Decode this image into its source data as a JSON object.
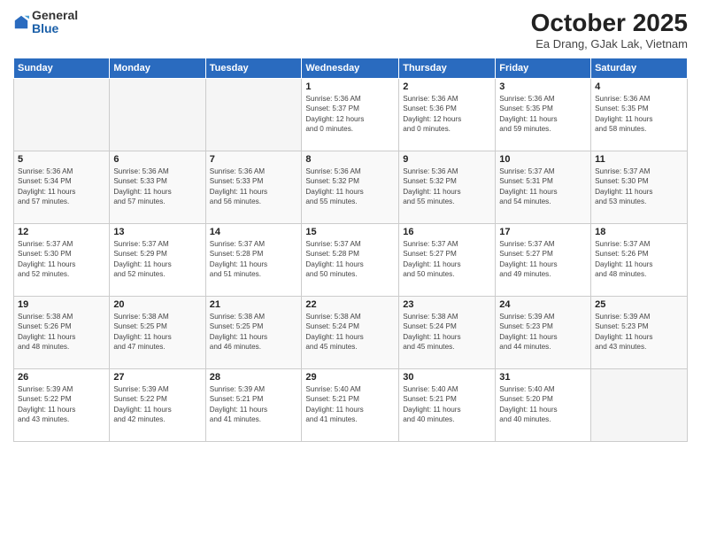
{
  "logo": {
    "general": "General",
    "blue": "Blue"
  },
  "header": {
    "month": "October 2025",
    "location": "Ea Drang, GJak Lak, Vietnam"
  },
  "weekdays": [
    "Sunday",
    "Monday",
    "Tuesday",
    "Wednesday",
    "Thursday",
    "Friday",
    "Saturday"
  ],
  "weeks": [
    [
      {
        "day": "",
        "info": ""
      },
      {
        "day": "",
        "info": ""
      },
      {
        "day": "",
        "info": ""
      },
      {
        "day": "1",
        "info": "Sunrise: 5:36 AM\nSunset: 5:37 PM\nDaylight: 12 hours\nand 0 minutes."
      },
      {
        "day": "2",
        "info": "Sunrise: 5:36 AM\nSunset: 5:36 PM\nDaylight: 12 hours\nand 0 minutes."
      },
      {
        "day": "3",
        "info": "Sunrise: 5:36 AM\nSunset: 5:35 PM\nDaylight: 11 hours\nand 59 minutes."
      },
      {
        "day": "4",
        "info": "Sunrise: 5:36 AM\nSunset: 5:35 PM\nDaylight: 11 hours\nand 58 minutes."
      }
    ],
    [
      {
        "day": "5",
        "info": "Sunrise: 5:36 AM\nSunset: 5:34 PM\nDaylight: 11 hours\nand 57 minutes."
      },
      {
        "day": "6",
        "info": "Sunrise: 5:36 AM\nSunset: 5:33 PM\nDaylight: 11 hours\nand 57 minutes."
      },
      {
        "day": "7",
        "info": "Sunrise: 5:36 AM\nSunset: 5:33 PM\nDaylight: 11 hours\nand 56 minutes."
      },
      {
        "day": "8",
        "info": "Sunrise: 5:36 AM\nSunset: 5:32 PM\nDaylight: 11 hours\nand 55 minutes."
      },
      {
        "day": "9",
        "info": "Sunrise: 5:36 AM\nSunset: 5:32 PM\nDaylight: 11 hours\nand 55 minutes."
      },
      {
        "day": "10",
        "info": "Sunrise: 5:37 AM\nSunset: 5:31 PM\nDaylight: 11 hours\nand 54 minutes."
      },
      {
        "day": "11",
        "info": "Sunrise: 5:37 AM\nSunset: 5:30 PM\nDaylight: 11 hours\nand 53 minutes."
      }
    ],
    [
      {
        "day": "12",
        "info": "Sunrise: 5:37 AM\nSunset: 5:30 PM\nDaylight: 11 hours\nand 52 minutes."
      },
      {
        "day": "13",
        "info": "Sunrise: 5:37 AM\nSunset: 5:29 PM\nDaylight: 11 hours\nand 52 minutes."
      },
      {
        "day": "14",
        "info": "Sunrise: 5:37 AM\nSunset: 5:28 PM\nDaylight: 11 hours\nand 51 minutes."
      },
      {
        "day": "15",
        "info": "Sunrise: 5:37 AM\nSunset: 5:28 PM\nDaylight: 11 hours\nand 50 minutes."
      },
      {
        "day": "16",
        "info": "Sunrise: 5:37 AM\nSunset: 5:27 PM\nDaylight: 11 hours\nand 50 minutes."
      },
      {
        "day": "17",
        "info": "Sunrise: 5:37 AM\nSunset: 5:27 PM\nDaylight: 11 hours\nand 49 minutes."
      },
      {
        "day": "18",
        "info": "Sunrise: 5:37 AM\nSunset: 5:26 PM\nDaylight: 11 hours\nand 48 minutes."
      }
    ],
    [
      {
        "day": "19",
        "info": "Sunrise: 5:38 AM\nSunset: 5:26 PM\nDaylight: 11 hours\nand 48 minutes."
      },
      {
        "day": "20",
        "info": "Sunrise: 5:38 AM\nSunset: 5:25 PM\nDaylight: 11 hours\nand 47 minutes."
      },
      {
        "day": "21",
        "info": "Sunrise: 5:38 AM\nSunset: 5:25 PM\nDaylight: 11 hours\nand 46 minutes."
      },
      {
        "day": "22",
        "info": "Sunrise: 5:38 AM\nSunset: 5:24 PM\nDaylight: 11 hours\nand 45 minutes."
      },
      {
        "day": "23",
        "info": "Sunrise: 5:38 AM\nSunset: 5:24 PM\nDaylight: 11 hours\nand 45 minutes."
      },
      {
        "day": "24",
        "info": "Sunrise: 5:39 AM\nSunset: 5:23 PM\nDaylight: 11 hours\nand 44 minutes."
      },
      {
        "day": "25",
        "info": "Sunrise: 5:39 AM\nSunset: 5:23 PM\nDaylight: 11 hours\nand 43 minutes."
      }
    ],
    [
      {
        "day": "26",
        "info": "Sunrise: 5:39 AM\nSunset: 5:22 PM\nDaylight: 11 hours\nand 43 minutes."
      },
      {
        "day": "27",
        "info": "Sunrise: 5:39 AM\nSunset: 5:22 PM\nDaylight: 11 hours\nand 42 minutes."
      },
      {
        "day": "28",
        "info": "Sunrise: 5:39 AM\nSunset: 5:21 PM\nDaylight: 11 hours\nand 41 minutes."
      },
      {
        "day": "29",
        "info": "Sunrise: 5:40 AM\nSunset: 5:21 PM\nDaylight: 11 hours\nand 41 minutes."
      },
      {
        "day": "30",
        "info": "Sunrise: 5:40 AM\nSunset: 5:21 PM\nDaylight: 11 hours\nand 40 minutes."
      },
      {
        "day": "31",
        "info": "Sunrise: 5:40 AM\nSunset: 5:20 PM\nDaylight: 11 hours\nand 40 minutes."
      },
      {
        "day": "",
        "info": ""
      }
    ]
  ]
}
